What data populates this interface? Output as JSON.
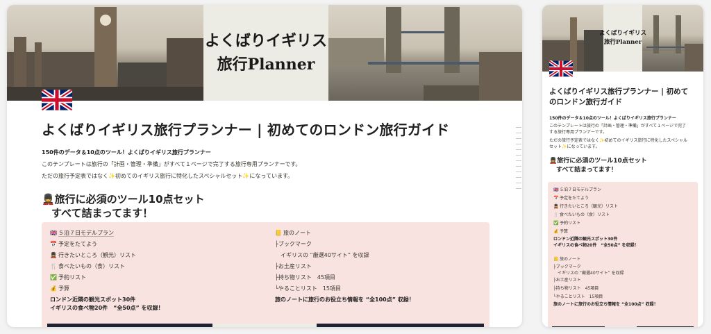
{
  "banner": {
    "title_line1": "よくばりイギリス",
    "title_line2": "旅行Planner"
  },
  "page": {
    "title": "よくばりイギリス旅行プランナー | 初めてのロンドン旅行ガイド",
    "lead": "150件のデータ＆10点のツール！よくばりイギリス旅行プランナー",
    "p1": "このテンプレートは旅行の「計画・管理・準備」がすべて１ページで完了する旅行専用プランナーです。",
    "p2": "ただの旅行予定表ではなく✨初めてのイギリス旅行に特化したスペシャルセット✨になっています。",
    "mob_p1a": "このテンプレートは旅行の「計画・管理・準備」がすべて１ページで完了",
    "mob_p1b": "する旅行専用プランナーです。",
    "mob_p2a": "ただの旅行予定表ではなく✨初めてのイギリス旅行に特化したスペシャル",
    "mob_p2b": "セット✨になっています。",
    "mob_title_a": "よくばりイギリス旅行プランナー | 初めて",
    "mob_title_b": "のロンドン旅行ガイド",
    "h2_line1": "💂旅行に必須のツール10点セット",
    "h2_line2": "すべて詰まってます！"
  },
  "tools_left": [
    {
      "icon": "🇬🇧",
      "label": "５泊７日モデルプラン",
      "underline": true
    },
    {
      "icon": "📅",
      "label": "予定をたてよう"
    },
    {
      "icon": "💂",
      "label": "行きたいところ（観光）リスト"
    },
    {
      "icon": "🍴",
      "label": "食べたいもの（食）リスト"
    },
    {
      "icon": "✅",
      "label": "予約リスト"
    },
    {
      "icon": "💰",
      "label": "予算"
    }
  ],
  "tools_left_note1": "ロンドン近隣の観光スポット30件",
  "tools_left_note2": "イギリスの食べ物20件　“全50点” を収録！",
  "tools_right": [
    {
      "icon": "📒",
      "label": "旅のノート"
    },
    {
      "icon": "",
      "label": "├ブックマーク"
    },
    {
      "icon": "",
      "label": "　イギリスの “厳選40サイト” を収録"
    },
    {
      "icon": "",
      "label": "├お土産リスト"
    },
    {
      "icon": "",
      "label": "├持ち物リスト　45項目"
    },
    {
      "icon": "",
      "label": "└やることリスト　15項目"
    }
  ],
  "tools_right_note": "旅のノートに旅行のお役立ち情報を “全100点” 収録！",
  "mob_tools": [
    {
      "icon": "🇬🇧",
      "label": "５泊７日モデルプラン"
    },
    {
      "icon": "📅",
      "label": "予定をたてよう"
    },
    {
      "icon": "💂",
      "label": "行きたいところ（観光）リスト"
    },
    {
      "icon": "🍴",
      "label": "食べたいもの（食）リスト"
    },
    {
      "icon": "✅",
      "label": "予約リスト"
    },
    {
      "icon": "💰",
      "label": "予算"
    }
  ],
  "mob_tools2": [
    {
      "icon": "📒",
      "label": "旅のノート"
    },
    {
      "icon": "",
      "label": "├ブックマーク"
    },
    {
      "icon": "",
      "label": "　イギリスの “厳選40サイト” を収録"
    },
    {
      "icon": "",
      "label": "├お土産リスト"
    },
    {
      "icon": "",
      "label": "├持ち物リスト　45項目"
    },
    {
      "icon": "",
      "label": "└やることリスト　15項目"
    }
  ],
  "colors": {
    "callout_bg": "#f8e3e0",
    "title_block_bg": "#ecebe4",
    "accent": "#1f1f1f"
  }
}
